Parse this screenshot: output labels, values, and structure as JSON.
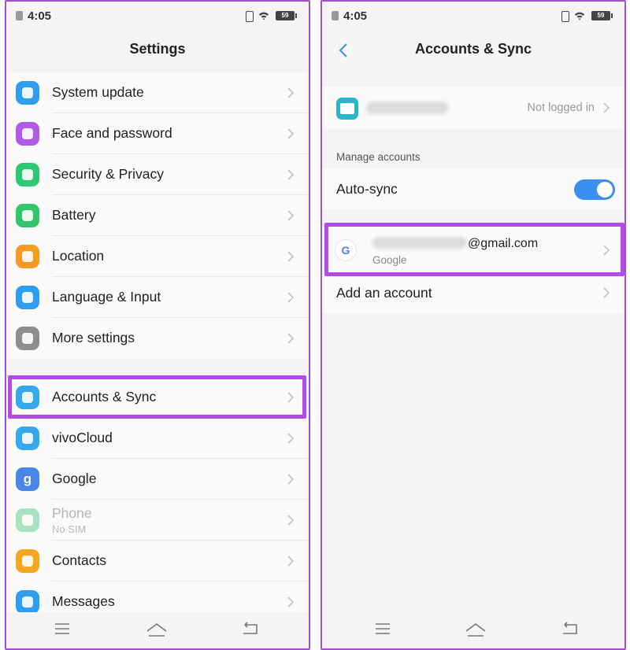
{
  "status_bar": {
    "time": "4:05",
    "battery": "59"
  },
  "left": {
    "title": "Settings",
    "group1": [
      {
        "label": "System update",
        "icon": "system-update-icon",
        "color": "#2f9df2"
      },
      {
        "label": "Face and password",
        "icon": "face-icon",
        "color": "#b05be8"
      },
      {
        "label": "Security & Privacy",
        "icon": "shield-icon",
        "color": "#2fc872"
      },
      {
        "label": "Battery",
        "icon": "battery-icon",
        "color": "#33c56a"
      },
      {
        "label": "Location",
        "icon": "location-icon",
        "color": "#f59a23"
      },
      {
        "label": "Language & Input",
        "icon": "keyboard-icon",
        "color": "#2f9df2"
      },
      {
        "label": "More settings",
        "icon": "gear-icon",
        "color": "#8e8e8e"
      }
    ],
    "group2": [
      {
        "label": "Accounts & Sync",
        "icon": "cloud-sync-icon",
        "color": "#35a8ee"
      },
      {
        "label": "vivoCloud",
        "icon": "cloud-icon",
        "color": "#35a8ee"
      },
      {
        "label": "Google",
        "icon": "google-icon",
        "color": "#4a86e8",
        "glyph": "g"
      },
      {
        "label": "Phone",
        "sublabel": "No SIM",
        "icon": "phone-icon",
        "color": "#a8e2c0",
        "disabled": true
      },
      {
        "label": "Contacts",
        "icon": "contacts-icon",
        "color": "#f5a623"
      },
      {
        "label": "Messages",
        "icon": "messages-icon",
        "color": "#2f9df2"
      }
    ]
  },
  "right": {
    "title": "Accounts & Sync",
    "vivo_account_status": "Not logged in",
    "manage_accounts_label": "Manage accounts",
    "auto_sync_label": "Auto-sync",
    "auto_sync_on": true,
    "google_email_suffix": "@gmail.com",
    "google_account_type": "Google",
    "add_account_label": "Add an account"
  },
  "colors": {
    "highlight": "#b44be6",
    "accent": "#3b8fee"
  }
}
